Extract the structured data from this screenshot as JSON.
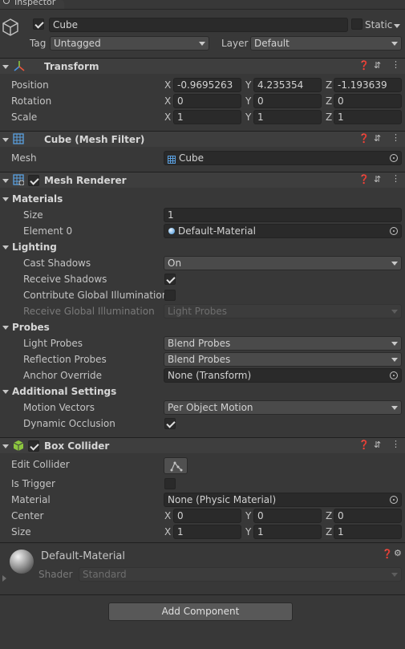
{
  "tab": {
    "title": "Inspector"
  },
  "object": {
    "name": "Cube",
    "static_label": "Static",
    "tag_label": "Tag",
    "tag_value": "Untagged",
    "layer_label": "Layer",
    "layer_value": "Default"
  },
  "transform": {
    "title": "Transform",
    "position": {
      "label": "Position",
      "x": "-0.9695263",
      "y": "4.235354",
      "z": "-1.193639"
    },
    "rotation": {
      "label": "Rotation",
      "x": "0",
      "y": "0",
      "z": "0"
    },
    "scale": {
      "label": "Scale",
      "x": "1",
      "y": "1",
      "z": "1"
    }
  },
  "axes": {
    "x": "X",
    "y": "Y",
    "z": "Z"
  },
  "mesh_filter": {
    "title": "Cube (Mesh Filter)",
    "mesh_label": "Mesh",
    "mesh_value": "Cube"
  },
  "mesh_renderer": {
    "title": "Mesh Renderer",
    "materials": {
      "label": "Materials",
      "size_label": "Size",
      "size_value": "1",
      "element_label": "Element 0",
      "element_value": "Default-Material"
    },
    "lighting": {
      "label": "Lighting",
      "cast_label": "Cast Shadows",
      "cast_value": "On",
      "receive_label": "Receive Shadows",
      "contribute_label": "Contribute Global Illumination",
      "receive_gi_label": "Receive Global Illumination",
      "receive_gi_value": "Light Probes"
    },
    "probes": {
      "label": "Probes",
      "light_label": "Light Probes",
      "light_value": "Blend Probes",
      "reflection_label": "Reflection Probes",
      "reflection_value": "Blend Probes",
      "anchor_label": "Anchor Override",
      "anchor_value": "None (Transform)"
    },
    "additional": {
      "label": "Additional Settings",
      "motion_label": "Motion Vectors",
      "motion_value": "Per Object Motion",
      "occlusion_label": "Dynamic Occlusion"
    }
  },
  "box_collider": {
    "title": "Box Collider",
    "edit_label": "Edit Collider",
    "trigger_label": "Is Trigger",
    "material_label": "Material",
    "material_value": "None (Physic Material)",
    "center": {
      "label": "Center",
      "x": "0",
      "y": "0",
      "z": "0"
    },
    "size": {
      "label": "Size",
      "x": "1",
      "y": "1",
      "z": "1"
    }
  },
  "material_panel": {
    "name": "Default-Material",
    "shader_label": "Shader",
    "shader_value": "Standard"
  },
  "add_component": "Add Component",
  "colors": {
    "background": "#383838",
    "header": "#3e3e3e",
    "field": "#2a2a2a",
    "transform_icon": "#e8553c",
    "collider_icon": "#8cc63f"
  }
}
